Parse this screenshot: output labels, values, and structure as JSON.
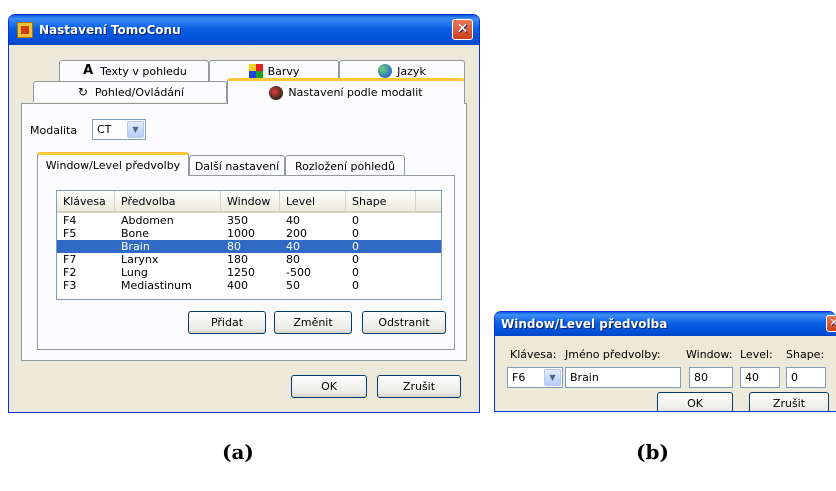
{
  "dialog_a": {
    "title": "Nastavení TomoConu",
    "top_tabs_row1": [
      "Texty v pohledu",
      "Barvy",
      "Jazyk"
    ],
    "top_tabs_row2": [
      "Pohled/Ovládání",
      "Nastavení podle modalit"
    ],
    "modality_label": "Modalita",
    "modality_value": "CT",
    "sub_tabs": [
      "Window/Level předvolby",
      "Další nastavení",
      "Rozložení pohledů"
    ],
    "columns": [
      "Klávesa",
      "Předvolba",
      "Window",
      "Level",
      "Shape"
    ],
    "rows": [
      [
        "F4",
        "Abdomen",
        "350",
        "40",
        "0"
      ],
      [
        "F5",
        "Bone",
        "1000",
        "200",
        "0"
      ],
      [
        "",
        "Brain",
        "80",
        "40",
        "0"
      ],
      [
        "F7",
        "Larynx",
        "180",
        "80",
        "0"
      ],
      [
        "F2",
        "Lung",
        "1250",
        "-500",
        "0"
      ],
      [
        "F3",
        "Mediastinum",
        "400",
        "50",
        "0"
      ]
    ],
    "selected_row": 2,
    "add_label": "Přidat",
    "change_label": "Změnit",
    "remove_label": "Odstranit",
    "ok_label": "OK",
    "cancel_label": "Zrušit"
  },
  "dialog_b": {
    "title": "Window/Level předvolba",
    "key_label": "Klávesa:",
    "name_label": "Jméno předvolby:",
    "window_label": "Window:",
    "level_label": "Level:",
    "shape_label": "Shape:",
    "key_value": "F6",
    "name_value": "Brain",
    "window_value": "80",
    "level_value": "40",
    "shape_value": "0",
    "ok_label": "OK",
    "cancel_label": "Zrušit"
  },
  "captions": {
    "a": "(a)",
    "b": "(b)"
  }
}
